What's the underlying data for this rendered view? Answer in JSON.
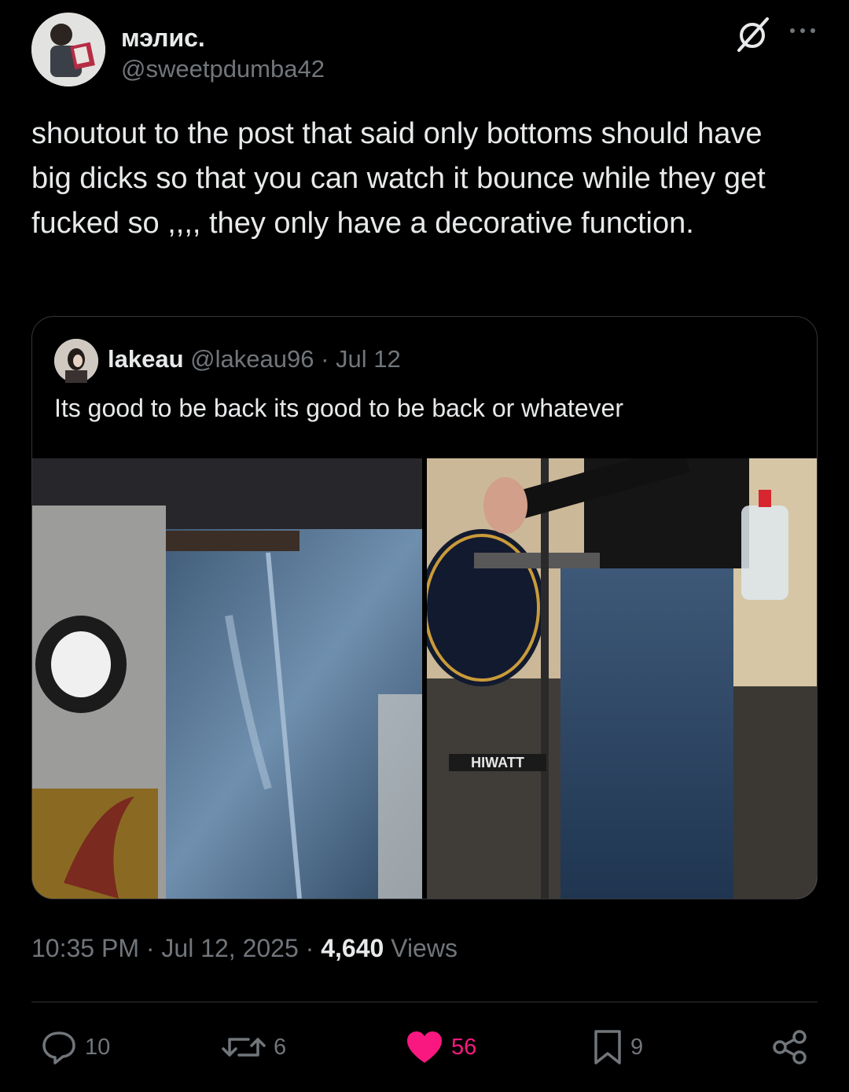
{
  "author": {
    "display_name": "мэлис.",
    "handle": "@sweetpdumba42"
  },
  "header_icons": [
    "grok-icon",
    "more-icon"
  ],
  "tweet": {
    "text": "shoutout to the post that said only bottoms should have big dicks so that you can watch it bounce while they get fucked so ,,,, they only have a decorative function."
  },
  "quoted_tweet": {
    "display_name": "lakeau",
    "handle": "@lakeau96",
    "separator": "·",
    "date": "Jul 12",
    "text": "Its good to be back its good to be back or whatever",
    "photo_right_label": "HIWATT"
  },
  "meta": {
    "time": "10:35 PM",
    "sep1": "·",
    "date": "Jul 12, 2025",
    "sep2": "·",
    "views_count": "4,640",
    "views_label": "Views"
  },
  "actions": {
    "replies": "10",
    "reposts": "6",
    "likes": "56",
    "bookmarks": "9"
  },
  "colors": {
    "background": "#000000",
    "text_primary": "#e7e9ea",
    "text_secondary": "#71767b",
    "like_pink": "#f91880",
    "border": "#333639"
  }
}
